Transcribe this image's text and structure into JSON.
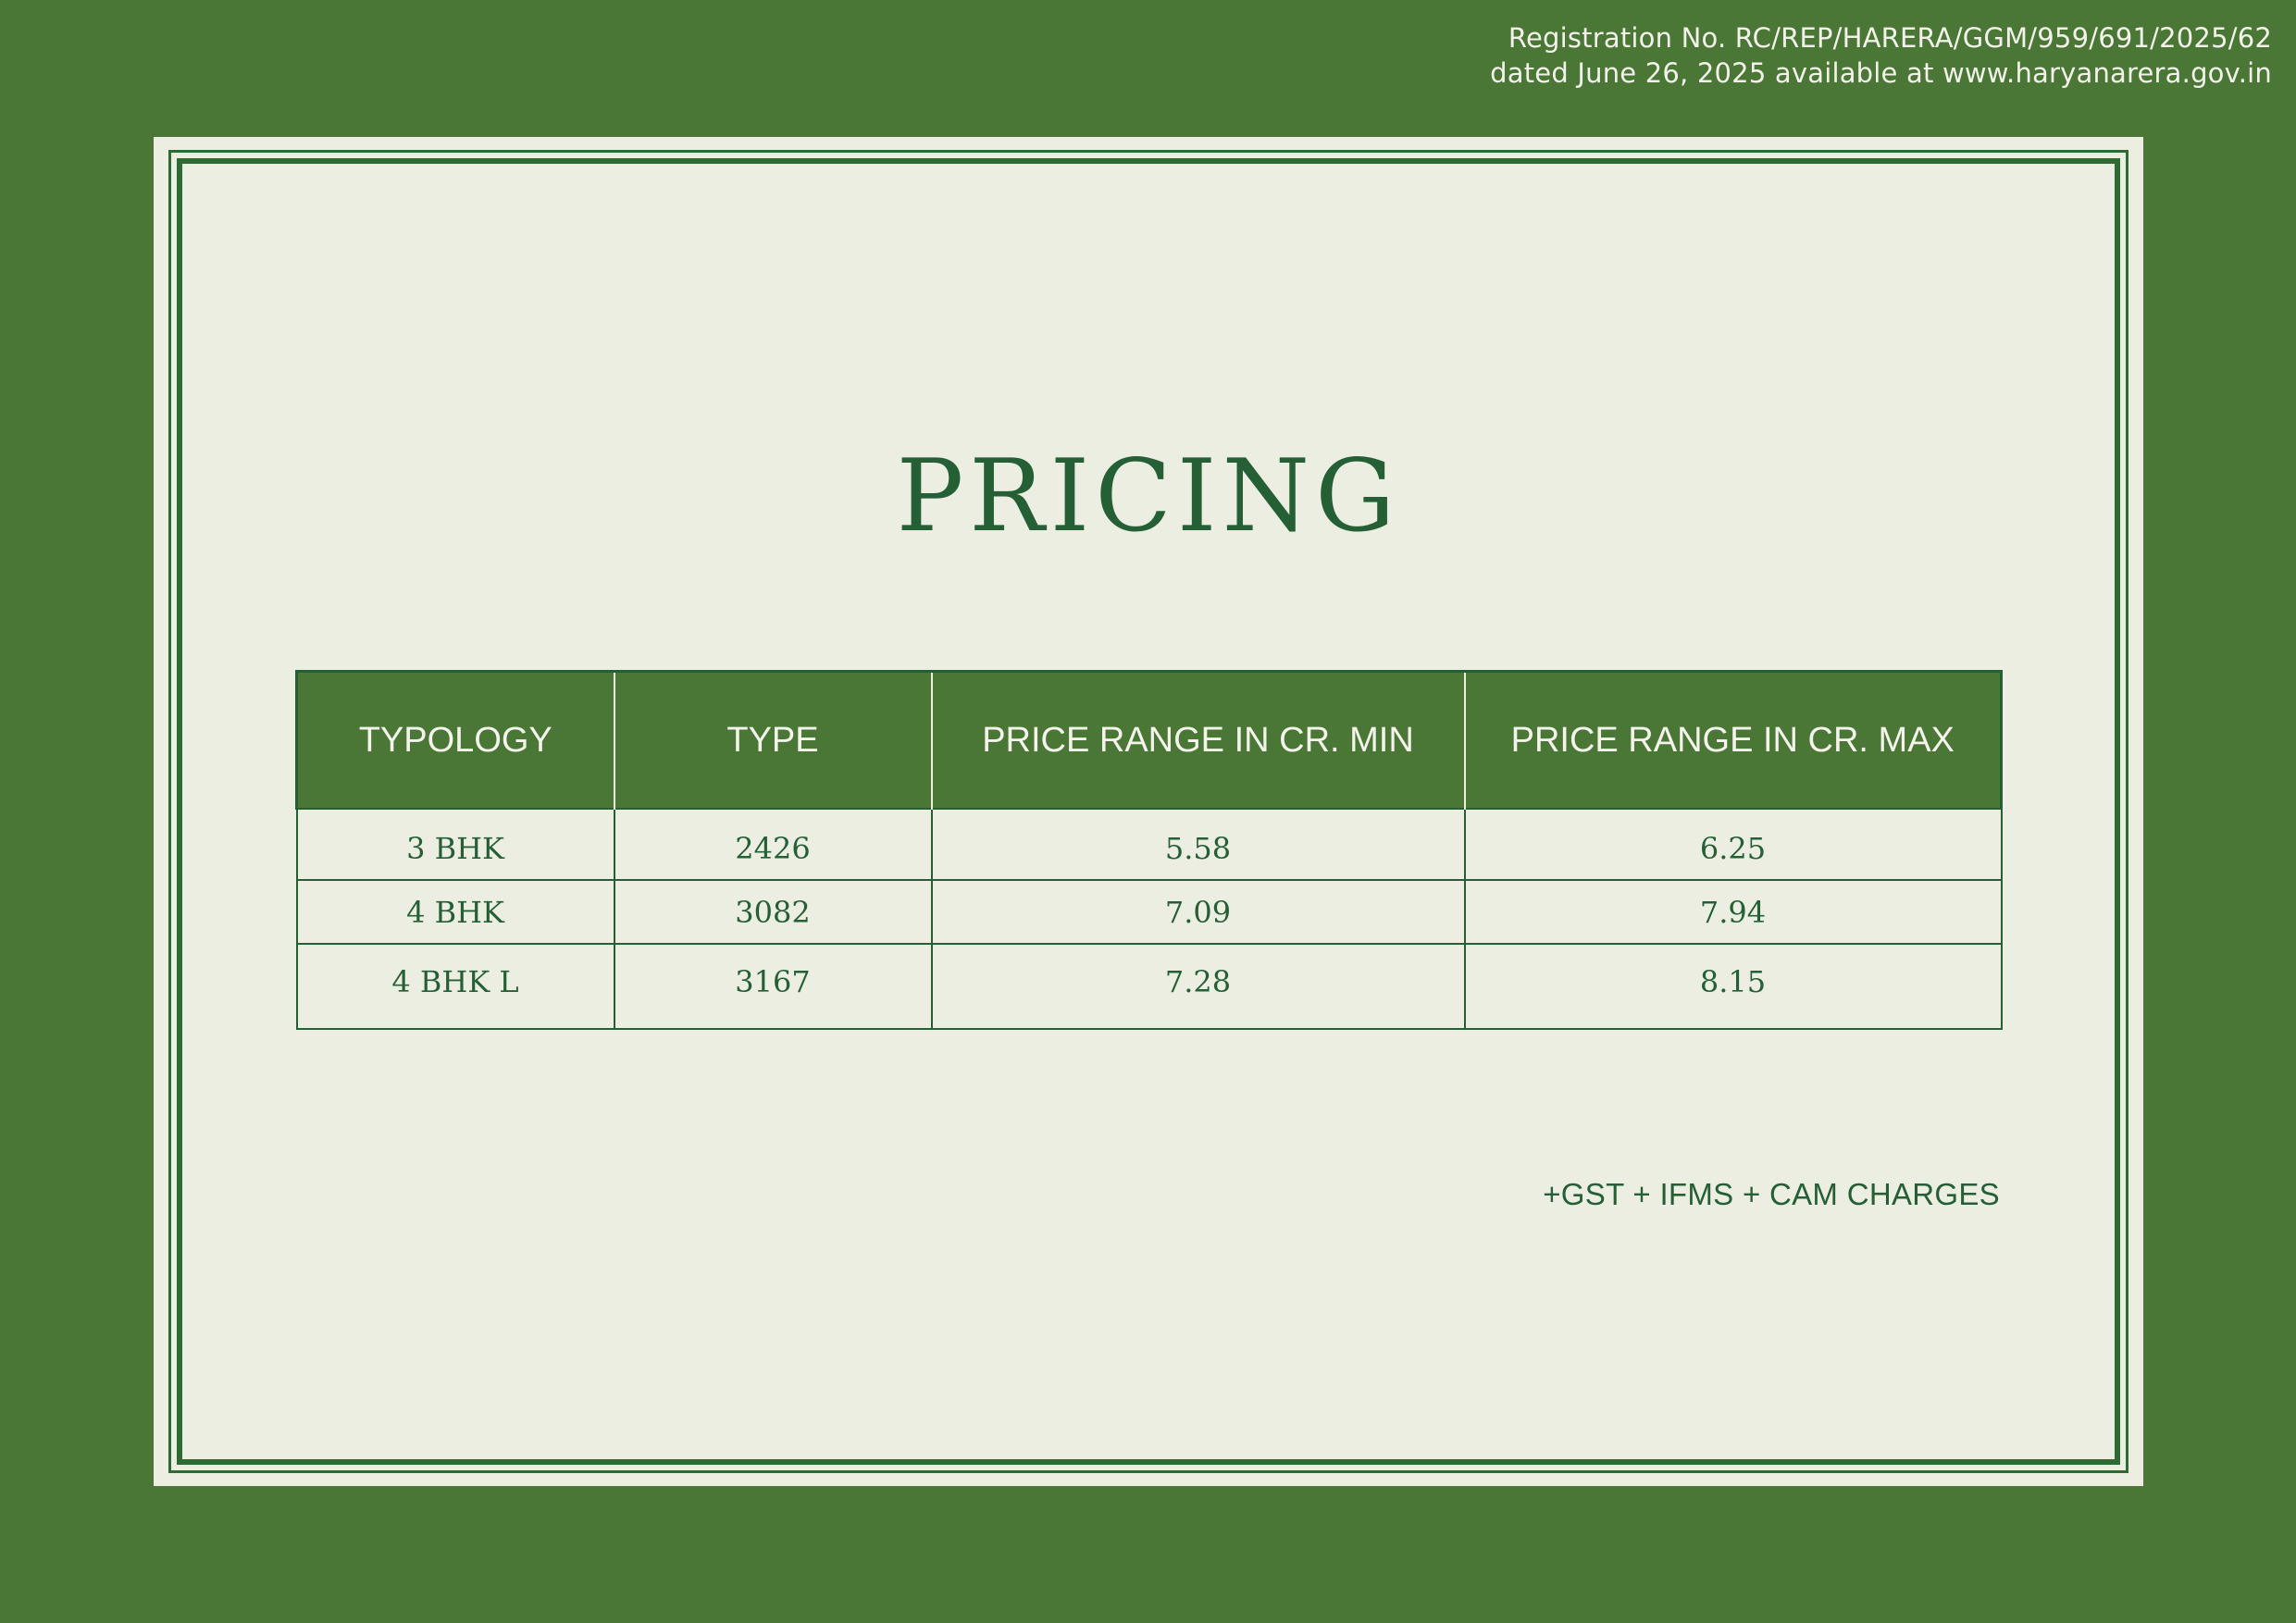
{
  "registration": {
    "line1": "Registration No. RC/REP/HARERA/GGM/959/691/2025/62",
    "line2": "dated June 26, 2025 available at www.haryanarera.gov.in"
  },
  "title": "PRICING",
  "table": {
    "headers": [
      "TYPOLOGY",
      "TYPE",
      "PRICE RANGE IN CR. MIN",
      "PRICE RANGE IN CR. MAX"
    ],
    "rows": [
      [
        "3 BHK",
        "2426",
        "5.58",
        "6.25"
      ],
      [
        "4 BHK",
        "3082",
        "7.09",
        "7.94"
      ],
      [
        "4 BHK L",
        "3167",
        "7.28",
        "8.15"
      ]
    ]
  },
  "footnote": "+GST + IFMS + CAM CHARGES",
  "colors": {
    "background": "#4a7636",
    "card": "#edeee2",
    "text_dark_green": "#255f36",
    "header_fill": "#4a7636"
  }
}
